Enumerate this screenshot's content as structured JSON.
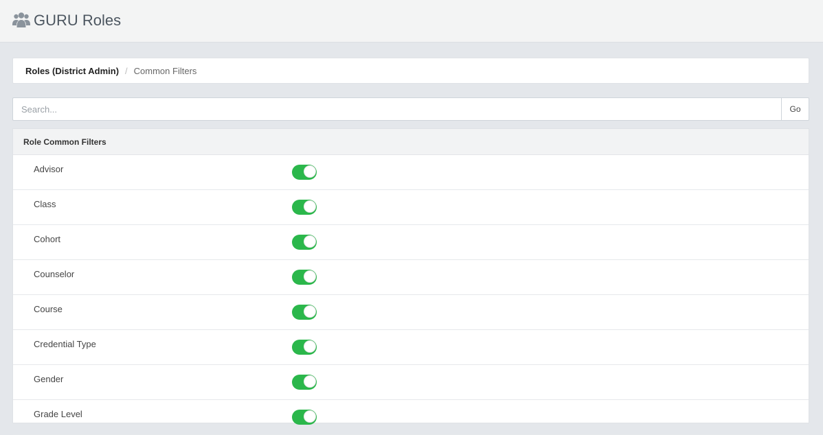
{
  "header": {
    "app_title": "GURU Roles",
    "logo_icon": "users-icon"
  },
  "breadcrumb": {
    "items": [
      "Roles (District Admin)",
      "Common Filters"
    ],
    "separator": "/"
  },
  "search": {
    "placeholder": "Search...",
    "value": "",
    "go_label": "Go"
  },
  "panel": {
    "title": "Role Common Filters",
    "filters": [
      {
        "label": "Advisor",
        "enabled": true
      },
      {
        "label": "Class",
        "enabled": true
      },
      {
        "label": "Cohort",
        "enabled": true
      },
      {
        "label": "Counselor",
        "enabled": true
      },
      {
        "label": "Course",
        "enabled": true
      },
      {
        "label": "Credential Type",
        "enabled": true
      },
      {
        "label": "Gender",
        "enabled": true
      },
      {
        "label": "Grade Level",
        "enabled": true
      }
    ]
  },
  "colors": {
    "toggle_on": "#2bb74b",
    "page_background": "#e4e7eb",
    "header_background": "#f3f4f4"
  }
}
